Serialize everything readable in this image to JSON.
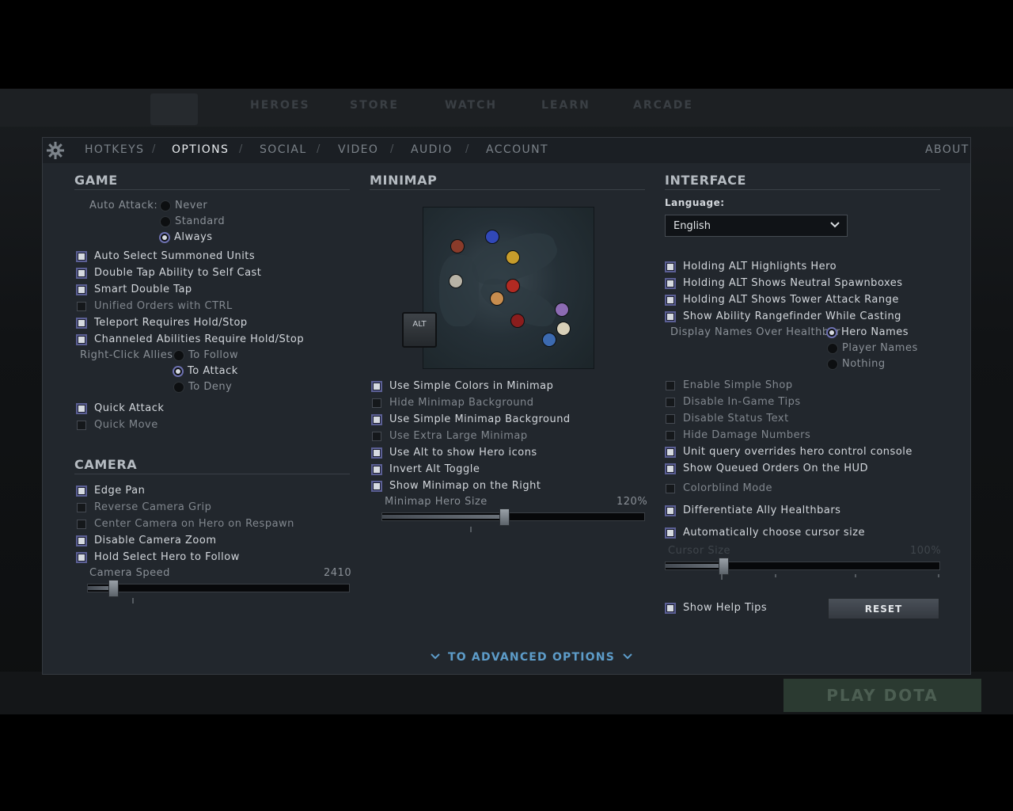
{
  "tabs": [
    {
      "label": "HOTKEYS"
    },
    {
      "label": "OPTIONS"
    },
    {
      "label": "SOCIAL"
    },
    {
      "label": "VIDEO"
    },
    {
      "label": "AUDIO"
    },
    {
      "label": "ACCOUNT"
    }
  ],
  "about_label": "ABOUT",
  "separator": "/",
  "game": {
    "title": "GAME",
    "auto_attack_label": "Auto Attack:",
    "auto_attack_options": [
      "Never",
      "Standard",
      "Always"
    ],
    "auto_attack_selected": "Always",
    "checks": [
      {
        "label": "Auto Select Summoned Units",
        "checked": true
      },
      {
        "label": "Double Tap Ability to Self Cast",
        "checked": true
      },
      {
        "label": "Smart Double Tap",
        "checked": true
      },
      {
        "label": "Unified Orders with CTRL",
        "checked": false
      },
      {
        "label": "Teleport Requires Hold/Stop",
        "checked": true
      },
      {
        "label": "Channeled Abilities Require Hold/Stop",
        "checked": true
      }
    ],
    "right_click_label": "Right-Click Allies",
    "right_click_options": [
      "To Follow",
      "To Attack",
      "To Deny"
    ],
    "right_click_selected": "To Attack",
    "checks2": [
      {
        "label": "Quick Attack",
        "checked": true
      },
      {
        "label": "Quick Move",
        "checked": false
      }
    ]
  },
  "camera": {
    "title": "CAMERA",
    "checks": [
      {
        "label": "Edge Pan",
        "checked": true
      },
      {
        "label": "Reverse Camera Grip",
        "checked": false
      },
      {
        "label": "Center Camera on Hero on Respawn",
        "checked": false
      },
      {
        "label": "Disable Camera Zoom",
        "checked": true
      },
      {
        "label": "Hold Select Hero to Follow",
        "checked": true
      }
    ],
    "speed_label": "Camera Speed",
    "speed_value": "2410",
    "speed_fraction": 0.08
  },
  "minimap": {
    "title": "MINIMAP",
    "alt_key_label": "ALT",
    "checks": [
      {
        "label": "Use Simple Colors in Minimap",
        "checked": true
      },
      {
        "label": "Hide Minimap Background",
        "checked": false
      },
      {
        "label": "Use Simple Minimap Background",
        "checked": true
      },
      {
        "label": "Use Extra Large Minimap",
        "checked": false
      },
      {
        "label": "Use Alt to show Hero icons",
        "checked": true
      },
      {
        "label": "Invert Alt Toggle",
        "checked": true
      },
      {
        "label": "Show Minimap on the Right",
        "checked": true
      }
    ],
    "hero_size_label": "Minimap Hero Size",
    "hero_size_value": "120%",
    "hero_size_fraction": 0.46,
    "hero_icon_colors": [
      "#8a3b2a",
      "#3148b8",
      "#c79c2b",
      "#b8b3a6",
      "#b12a22",
      "#c88d4e",
      "#8a1d1d",
      "#8c6bb3",
      "#3c6ab0",
      "#d8d0b8"
    ]
  },
  "interface": {
    "title": "INTERFACE",
    "language_label": "Language:",
    "language_value": "English",
    "checks": [
      {
        "label": "Holding ALT Highlights Hero",
        "checked": true
      },
      {
        "label": "Holding ALT Shows Neutral Spawnboxes",
        "checked": true
      },
      {
        "label": "Holding ALT Shows Tower Attack Range",
        "checked": true
      },
      {
        "label": "Show Ability Rangefinder While Casting",
        "checked": true
      }
    ],
    "display_names_label": "Display Names Over Healthbar",
    "display_names_options": [
      "Hero Names",
      "Player Names",
      "Nothing"
    ],
    "display_names_selected": "Hero Names",
    "checks2": [
      {
        "label": "Enable Simple Shop",
        "checked": false
      },
      {
        "label": "Disable In-Game Tips",
        "checked": false
      },
      {
        "label": "Disable Status Text",
        "checked": false
      },
      {
        "label": "Hide Damage Numbers",
        "checked": false
      },
      {
        "label": "Unit query overrides hero control console",
        "checked": true
      },
      {
        "label": "Show Queued Orders On the HUD",
        "checked": true
      },
      {
        "label": "Colorblind Mode",
        "checked": false
      },
      {
        "label": "Differentiate Ally Healthbars",
        "checked": true
      },
      {
        "label": "Automatically choose cursor size",
        "checked": true
      }
    ],
    "cursor_size_label": "Cursor Size",
    "cursor_size_value": "100%",
    "cursor_size_fraction": 0.2,
    "help_tips_label": "Show Help Tips",
    "help_tips_checked": true,
    "reset_label": "RESET"
  },
  "advanced_label": "TO ADVANCED OPTIONS",
  "background": {
    "nav": [
      "HEROES",
      "STORE",
      "WATCH",
      "LEARN",
      "ARCADE"
    ],
    "play_label": "PLAY DOTA"
  }
}
